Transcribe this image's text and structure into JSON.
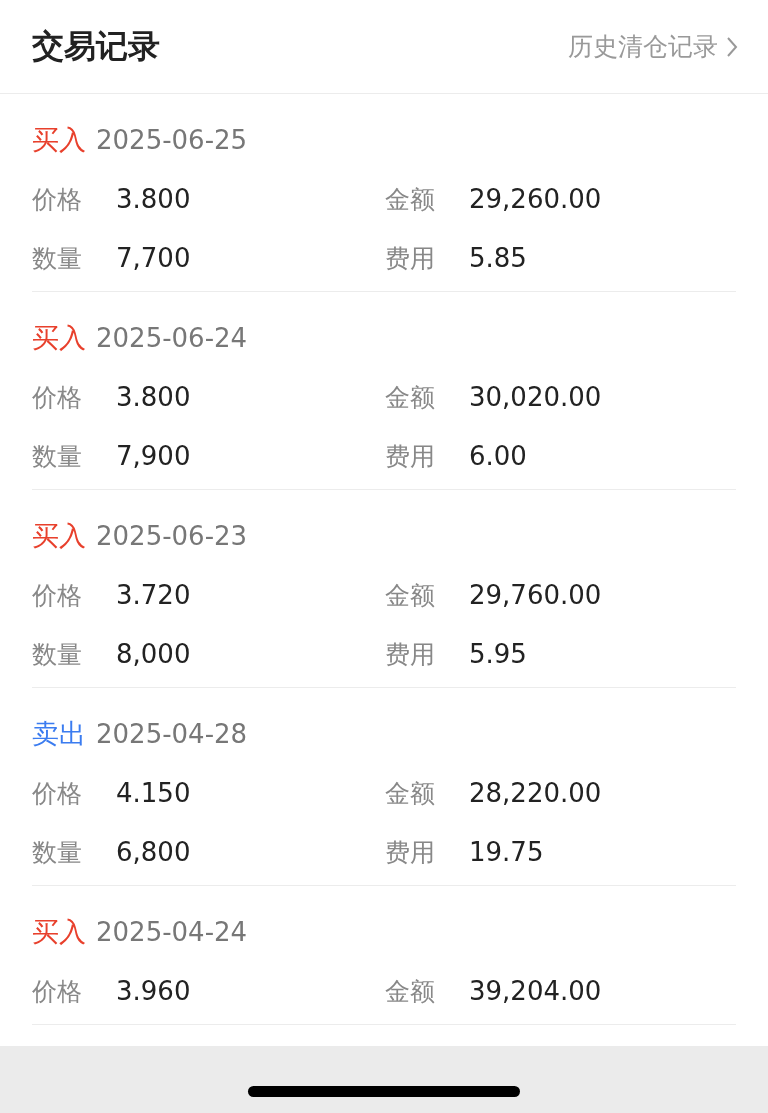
{
  "header": {
    "title": "交易记录",
    "history_link": "历史清仓记录"
  },
  "records": [
    {
      "kind": "buy",
      "type": "买入",
      "date": "2025-06-25",
      "fields": [
        {
          "label": "价格",
          "value": "3.800"
        },
        {
          "label": "金额",
          "value": "29,260.00"
        },
        {
          "label": "数量",
          "value": "7,700"
        },
        {
          "label": "费用",
          "value": "5.85"
        }
      ]
    },
    {
      "kind": "buy",
      "type": "买入",
      "date": "2025-06-24",
      "fields": [
        {
          "label": "价格",
          "value": "3.800"
        },
        {
          "label": "金额",
          "value": "30,020.00"
        },
        {
          "label": "数量",
          "value": "7,900"
        },
        {
          "label": "费用",
          "value": "6.00"
        }
      ]
    },
    {
      "kind": "buy",
      "type": "买入",
      "date": "2025-06-23",
      "fields": [
        {
          "label": "价格",
          "value": "3.720"
        },
        {
          "label": "金额",
          "value": "29,760.00"
        },
        {
          "label": "数量",
          "value": "8,000"
        },
        {
          "label": "费用",
          "value": "5.95"
        }
      ]
    },
    {
      "kind": "sell",
      "type": "卖出",
      "date": "2025-04-28",
      "fields": [
        {
          "label": "价格",
          "value": "4.150"
        },
        {
          "label": "金额",
          "value": "28,220.00"
        },
        {
          "label": "数量",
          "value": "6,800"
        },
        {
          "label": "费用",
          "value": "19.75"
        }
      ]
    },
    {
      "kind": "buy",
      "type": "买入",
      "date": "2025-04-24",
      "fields": [
        {
          "label": "价格",
          "value": "3.960"
        },
        {
          "label": "金额",
          "value": "39,204.00"
        }
      ]
    }
  ]
}
